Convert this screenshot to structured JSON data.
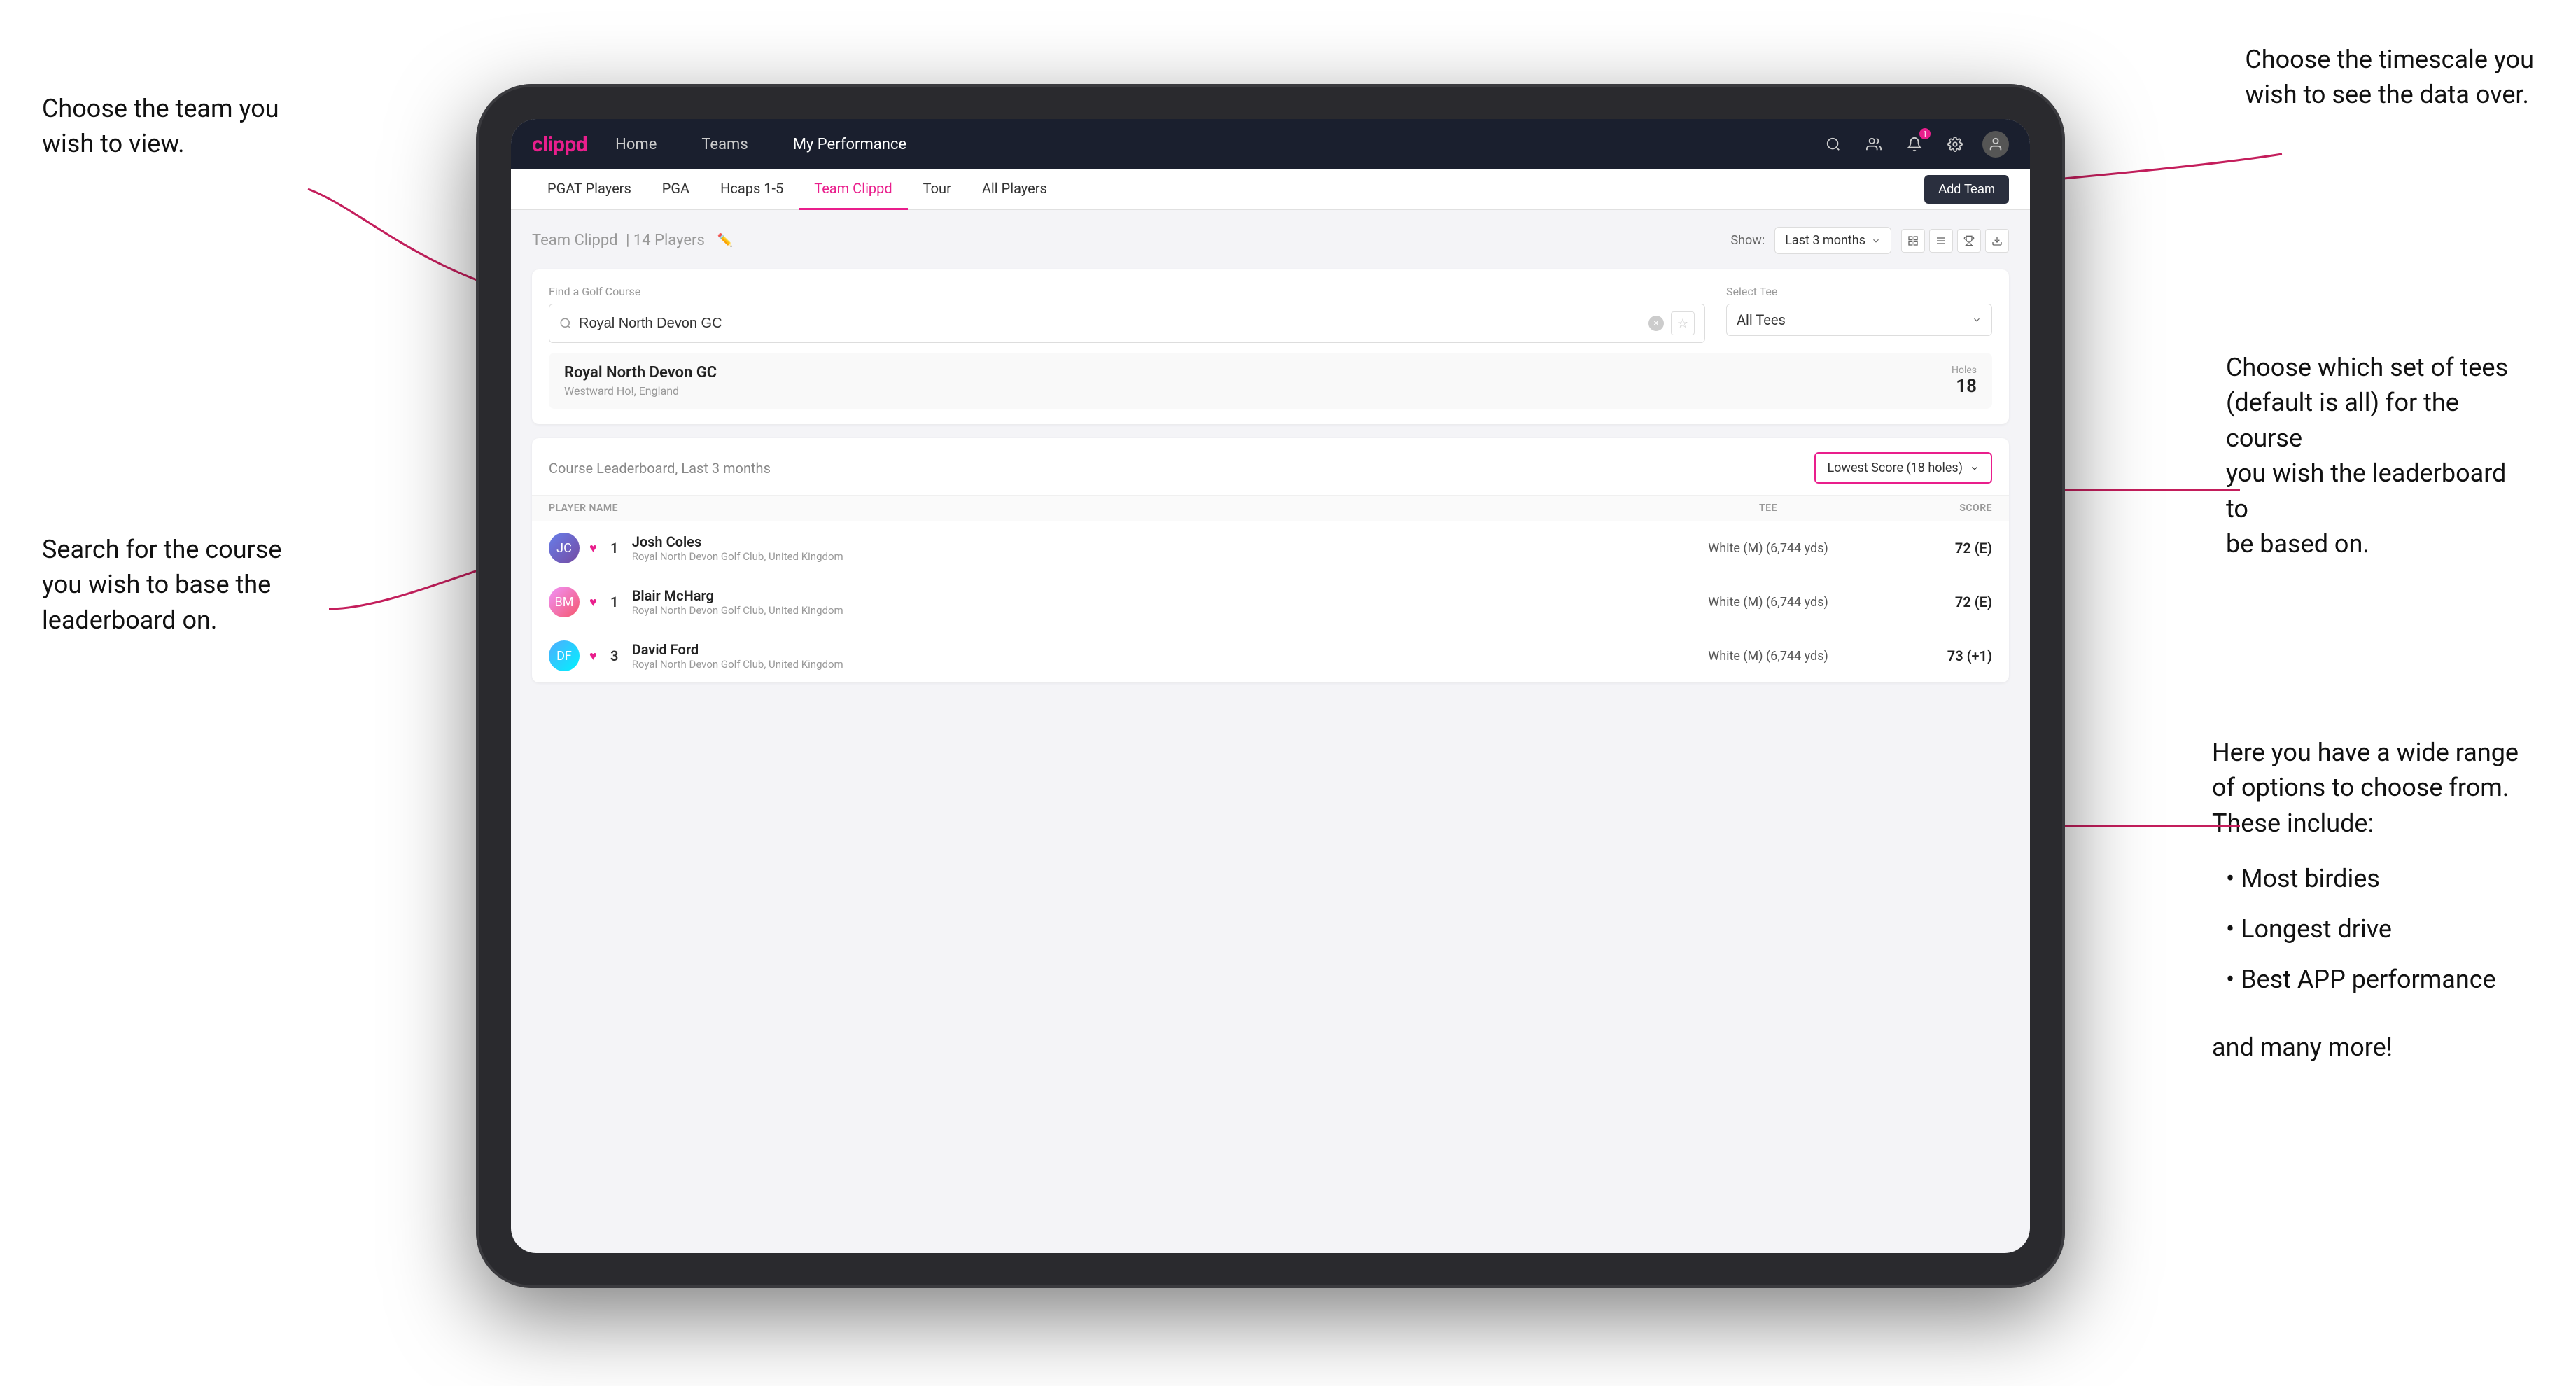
{
  "annotations": {
    "team_label": "Choose the team you\nwish to view.",
    "timescale_label": "Choose the timescale you\nwish to see the data over.",
    "course_search_label": "Search for the course\nyou wish to base the\nleaderboard on.",
    "tee_select_label": "Choose which set of tees\n(default is all) for the course\nyou wish the leaderboard to\nbe based on.",
    "options_label": "Here you have a wide range\nof options to choose from.\nThese include:",
    "options_list": [
      "Most birdies",
      "Longest drive",
      "Best APP performance"
    ],
    "options_more": "and many more!"
  },
  "nav": {
    "logo": "clippd",
    "links": [
      "Home",
      "Teams",
      "My Performance"
    ],
    "active_link": "My Performance",
    "icons": {
      "search": "🔍",
      "people": "👤",
      "bell": "🔔",
      "settings": "⚙",
      "avatar": "👤"
    }
  },
  "sub_nav": {
    "links": [
      "PGAT Players",
      "PGA",
      "Hcaps 1-5",
      "Team Clippd",
      "Tour",
      "All Players"
    ],
    "active_link": "Team Clippd",
    "add_team_label": "Add Team"
  },
  "team_header": {
    "title": "Team Clippd",
    "player_count": "14 Players",
    "show_label": "Show:",
    "show_value": "Last 3 months"
  },
  "search": {
    "find_label": "Find a Golf Course",
    "placeholder": "Royal North Devon GC",
    "value": "Royal North Devon GC",
    "tee_label": "Select Tee",
    "tee_value": "All Tees"
  },
  "course_result": {
    "name": "Royal North Devon GC",
    "location": "Westward Ho!, England",
    "holes_label": "Holes",
    "holes": "18"
  },
  "leaderboard": {
    "title": "Course Leaderboard,",
    "subtitle": "Last 3 months",
    "score_option": "Lowest Score (18 holes)",
    "col_player": "PLAYER NAME",
    "col_tee": "TEE",
    "col_score": "SCORE",
    "rows": [
      {
        "rank": "1",
        "name": "Josh Coles",
        "club": "Royal North Devon Golf Club, United Kingdom",
        "tee": "White (M) (6,744 yds)",
        "score": "72 (E)",
        "avatar_initials": "JC"
      },
      {
        "rank": "1",
        "name": "Blair McHarg",
        "club": "Royal North Devon Golf Club, United Kingdom",
        "tee": "White (M) (6,744 yds)",
        "score": "72 (E)",
        "avatar_initials": "BM"
      },
      {
        "rank": "3",
        "name": "David Ford",
        "club": "Royal North Devon Golf Club, United Kingdom",
        "tee": "White (M) (6,744 yds)",
        "score": "73 (+1)",
        "avatar_initials": "DF"
      }
    ]
  }
}
